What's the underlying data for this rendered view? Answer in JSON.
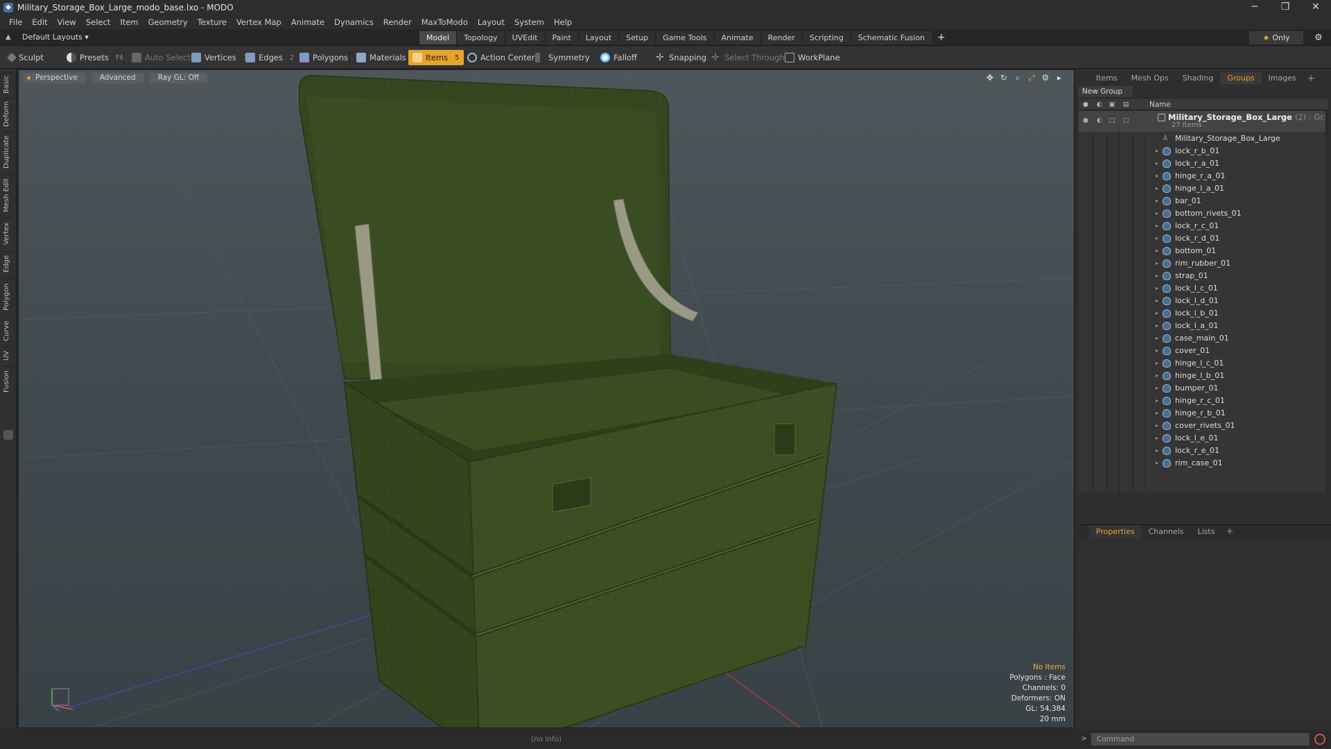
{
  "window": {
    "title": "Military_Storage_Box_Large_modo_base.lxo - MODO",
    "minimize": "─",
    "maximize": "❐",
    "close": "✕"
  },
  "menu": [
    "File",
    "Edit",
    "View",
    "Select",
    "Item",
    "Geometry",
    "Texture",
    "Vertex Map",
    "Animate",
    "Dynamics",
    "Render",
    "MaxToModo",
    "Layout",
    "System",
    "Help"
  ],
  "layoutbar": {
    "layouts_label": "Default Layouts ▾",
    "tabs": [
      "Model",
      "Topology",
      "UVEdit",
      "Paint",
      "Layout",
      "Setup",
      "Game Tools",
      "Animate",
      "Render",
      "Scripting",
      "Schematic Fusion"
    ],
    "active_tab": "Model",
    "add": "+",
    "only_label": "Only"
  },
  "toolbar": {
    "sculpt": "Sculpt",
    "presets": "Presets",
    "presets_key": "F6",
    "auto_select": "Auto Select",
    "vertices": "Vertices",
    "vertices_key": "1",
    "edges": "Edges",
    "edges_key": "2",
    "polygons": "Polygons",
    "materials": "Materials",
    "items": "Items",
    "items_key": "5",
    "action_center": "Action Center",
    "symmetry": "Symmetry",
    "falloff": "Falloff",
    "snapping": "Snapping",
    "select_through": "Select Through",
    "workplane": "WorkPlane"
  },
  "left_tabs": [
    "Basic",
    "Deform",
    "Duplicate",
    "Mesh Edit",
    "Vertex",
    "Edge",
    "Polygon",
    "Curve",
    "UV",
    "Fusion"
  ],
  "viewport": {
    "view_mode": "Perspective",
    "shading": "Advanced",
    "raygl": "Ray GL: Off",
    "info": {
      "selection": "No Items",
      "polygons": "Polygons : Face",
      "channels": "Channels: 0",
      "deformers": "Deformers: ON",
      "gl": "GL: 54,384",
      "scale": "20 mm"
    },
    "colors": {
      "box": "#3c4d22",
      "box_dark": "#2c3a18",
      "wire": "#56693a",
      "strap": "#9a9a84"
    }
  },
  "status": {
    "info": "(no info)"
  },
  "right_panel": {
    "tabs": [
      "Items",
      "Mesh Ops",
      "Shading",
      "Groups",
      "Images"
    ],
    "active_tab": "Groups",
    "new_group": "New Group",
    "column_name": "Name",
    "group": {
      "name": "Military_Storage_Box_Large",
      "count": "(2) : Gr...",
      "sub": "27 Items"
    },
    "locator": "Military_Storage_Box_Large",
    "items": [
      "lock_r_b_01",
      "lock_r_a_01",
      "hinge_r_a_01",
      "hinge_l_a_01",
      "bar_01",
      "bottom_rivets_01",
      "lock_r_c_01",
      "lock_r_d_01",
      "bottom_01",
      "rim_rubber_01",
      "strap_01",
      "lock_l_c_01",
      "lock_l_d_01",
      "lock_l_b_01",
      "lock_l_a_01",
      "case_main_01",
      "cover_01",
      "hinge_l_c_01",
      "hinge_l_b_01",
      "bumper_01",
      "hinge_r_c_01",
      "hinge_r_b_01",
      "cover_rivets_01",
      "lock_l_e_01",
      "lock_r_e_01",
      "rim_case_01"
    ],
    "props_tabs": [
      "Properties",
      "Channels",
      "Lists"
    ],
    "props_active": "Properties"
  },
  "command": {
    "placeholder": "Command",
    "prompt": ">"
  },
  "colors": {
    "accent": "#e8a32a",
    "panel": "#2e2e2e",
    "viewport_top": "#4f565b"
  }
}
